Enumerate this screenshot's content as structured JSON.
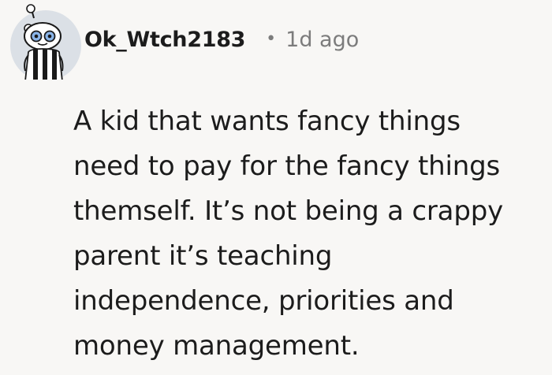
{
  "comment": {
    "author": {
      "username": "Ok_Wtch2183",
      "avatar": "reddit-snoo-avatar-icon"
    },
    "separator": "•",
    "timestamp": "1d ago",
    "body": "A kid that wants fancy things\nneed to pay for the fancy things\nthemself. It’s not being a crappy\nparent it’s teaching\nindependence, priorities and\nmoney management."
  },
  "colors": {
    "background": "#f8f7f5",
    "text_primary": "#1c1c1c",
    "text_meta": "#7c7c7c",
    "avatar_bg": "#dbe0e6"
  }
}
